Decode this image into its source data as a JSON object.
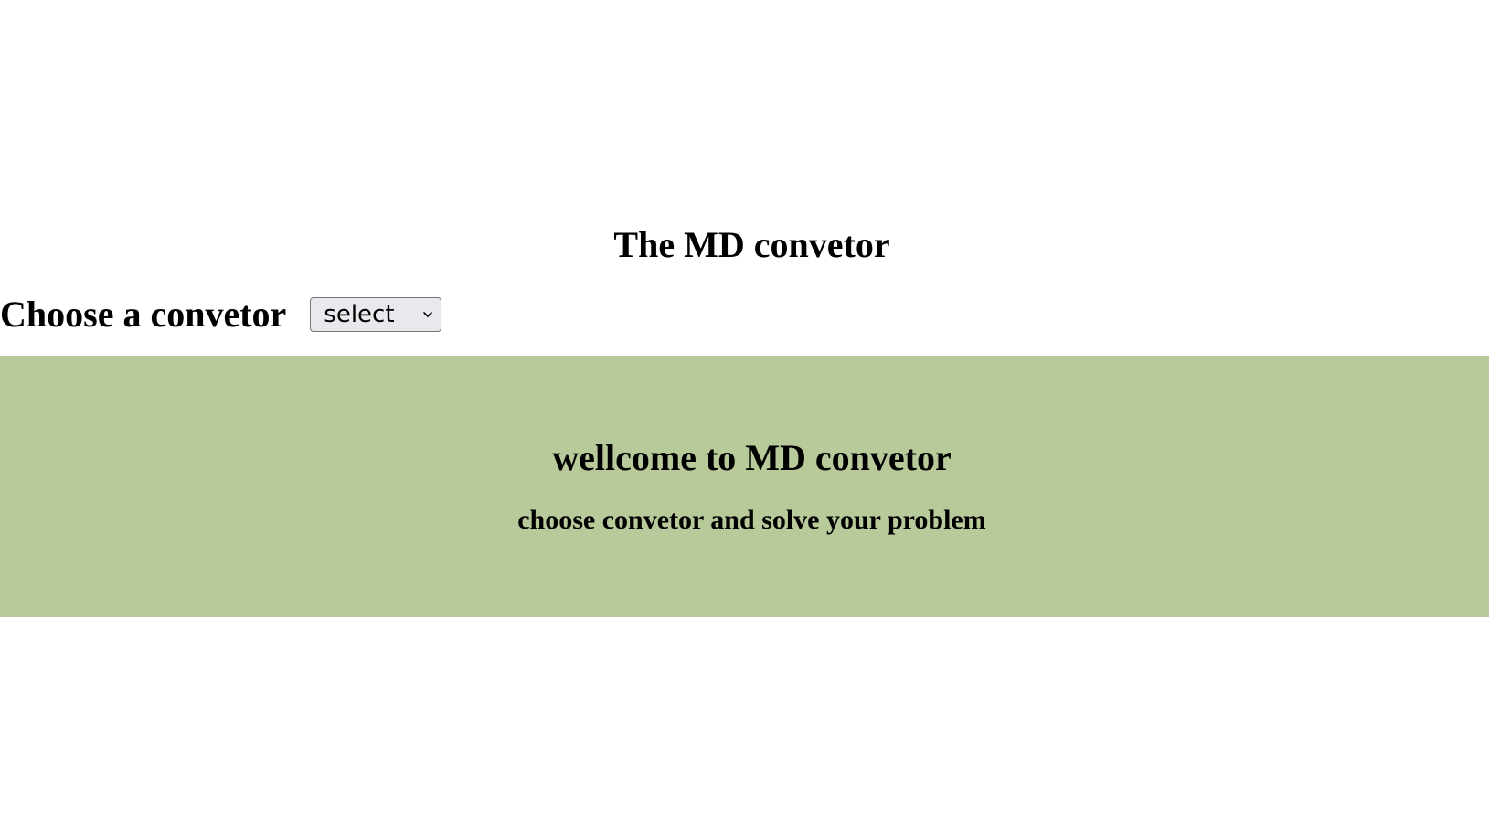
{
  "header": {
    "title": "The MD convetor"
  },
  "chooser": {
    "label": "Choose a convetor",
    "select": {
      "selected_value": "select",
      "icon": "chevron-down-icon"
    }
  },
  "welcome": {
    "title": "wellcome to MD convetor",
    "subtitle": "choose convetor and solve your problem",
    "background_color": "#b8c99a"
  }
}
